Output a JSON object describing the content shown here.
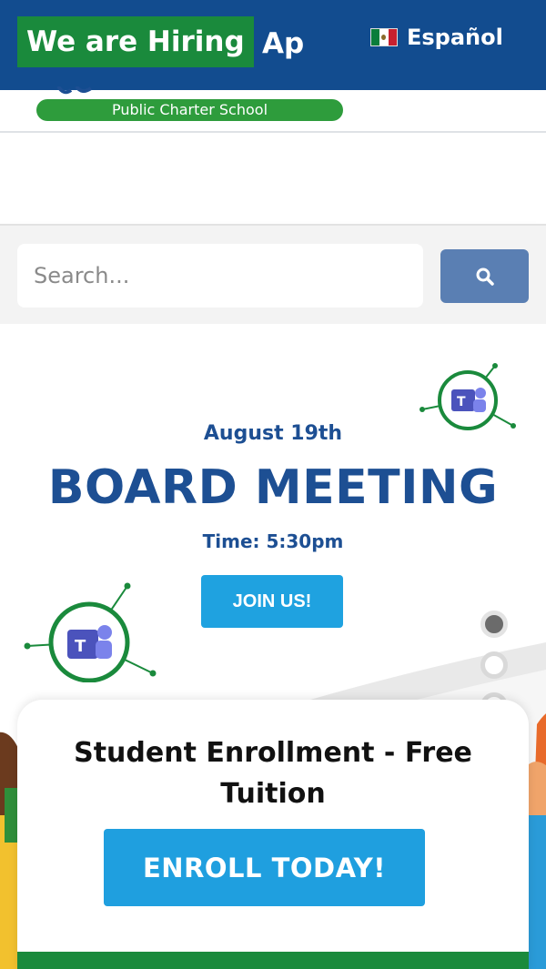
{
  "topbar": {
    "hiring_label": "We are Hiring",
    "hiring_trailing": "Ap",
    "language_label": "Español",
    "language_flag": "mexico-flag-icon"
  },
  "logo": {
    "school_label": "Public Charter School"
  },
  "search": {
    "placeholder": "Search...",
    "button_icon": "search-icon"
  },
  "hero": {
    "date": "August 19th",
    "title": "BOARD MEETING",
    "time": "Time: 5:30pm",
    "join_label": "JOIN US!",
    "icon": "teams-icon"
  },
  "slider": {
    "active_index": 0,
    "count": 3
  },
  "enrollment": {
    "title": "Student Enrollment - Free Tuition",
    "button_label": "ENROLL TODAY!"
  },
  "colors": {
    "topbar": "#124c8f",
    "hiring_bg": "#1a8a3c",
    "accent_blue": "#1fa2e0",
    "heading_blue": "#1d4f93",
    "search_button": "#5a7fb3"
  }
}
